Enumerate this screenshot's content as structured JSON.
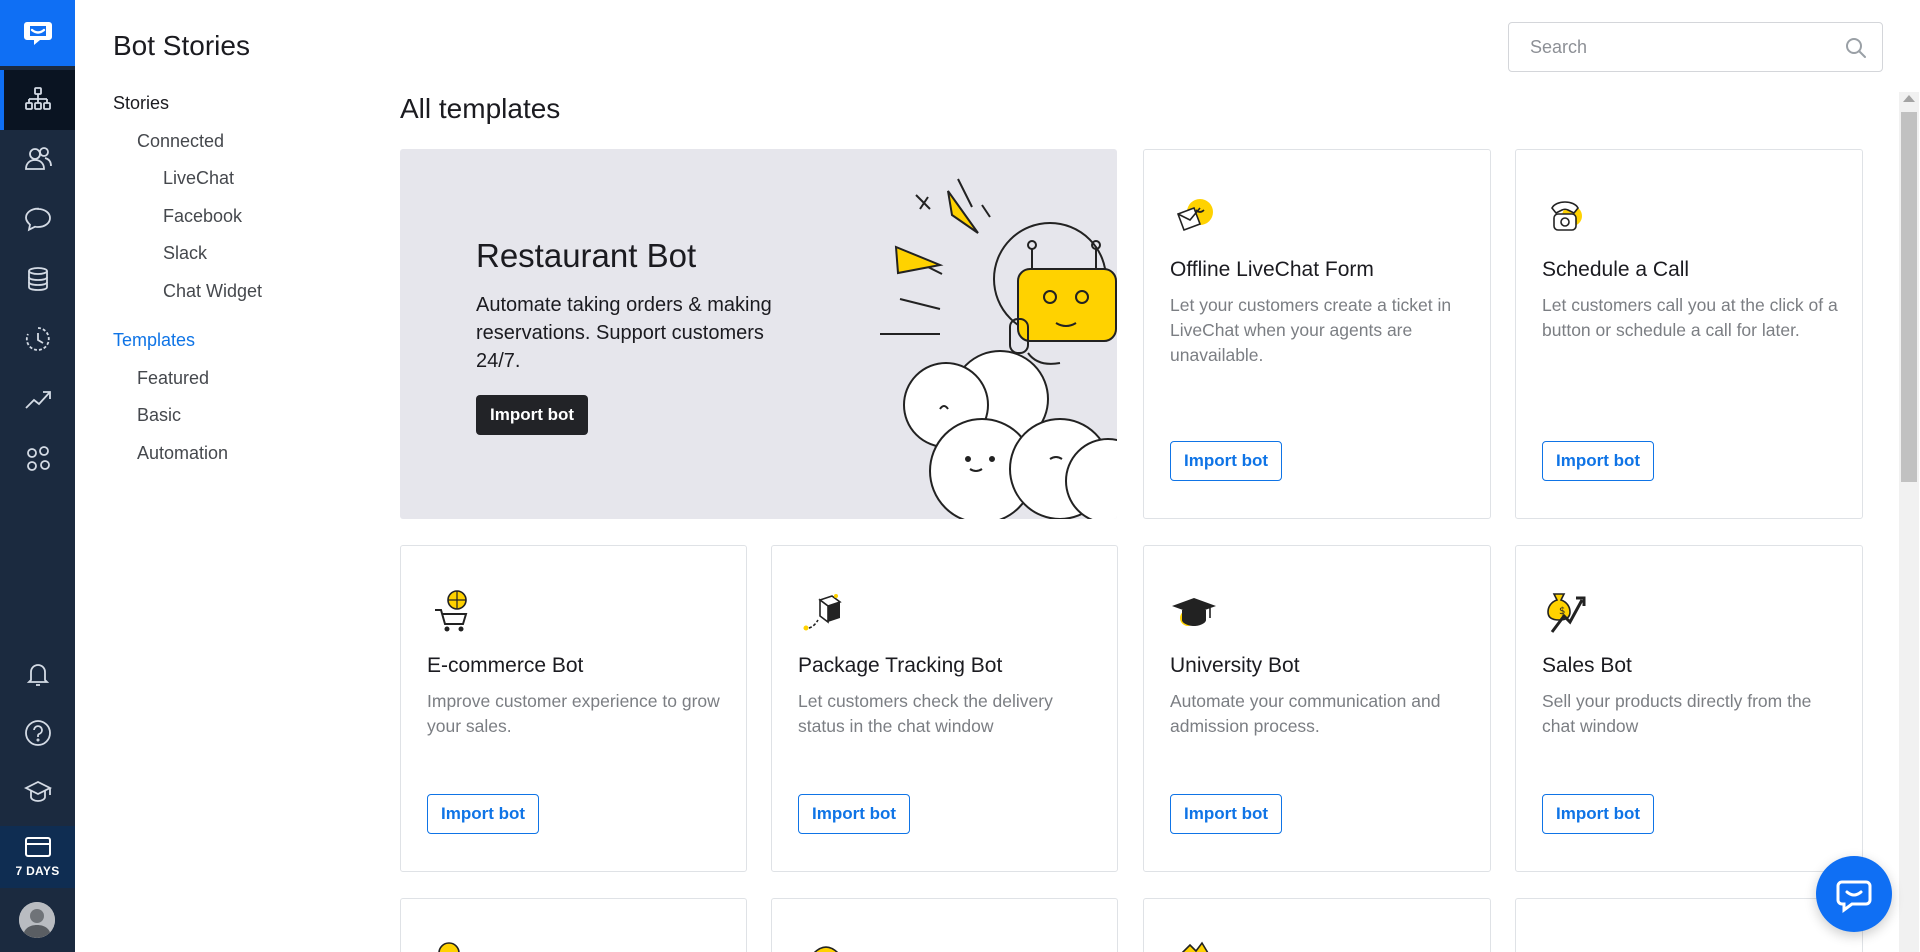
{
  "app": {
    "brand_color": "#0f6ff4",
    "rail_color": "#1b2a3f"
  },
  "rail": {
    "trial_label": "7 DAYS",
    "items": [
      "bot-stories-icon",
      "users-icon",
      "chat-icon",
      "database-icon",
      "history-icon",
      "reports-icon",
      "integrations-icon",
      "bell-icon",
      "help-icon",
      "academy-icon"
    ]
  },
  "subnav": {
    "title": "Bot Stories",
    "stories": "Stories",
    "connected": "Connected",
    "livechat": "LiveChat",
    "facebook": "Facebook",
    "slack": "Slack",
    "chat_widget": "Chat Widget",
    "templates": "Templates",
    "featured": "Featured",
    "basic": "Basic",
    "automation": "Automation"
  },
  "search": {
    "placeholder": "Search"
  },
  "main": {
    "title": "All templates",
    "hero": {
      "title": "Restaurant Bot",
      "description": "Automate taking orders & making reservations. Support customers 24/7.",
      "button": "Import bot"
    },
    "cards": [
      {
        "title": "Offline LiveChat Form",
        "description": "Let your customers create a ticket in LiveChat when your agents are unavailable.",
        "button": "Import bot",
        "icon": "envelope-icon"
      },
      {
        "title": "Schedule a Call",
        "description": "Let customers call you at the click of a button or schedule a call for later.",
        "button": "Import bot",
        "icon": "phone-icon"
      },
      {
        "title": "E-commerce Bot",
        "description": "Improve customer experience to grow your sales.",
        "button": "Import bot",
        "icon": "cart-icon"
      },
      {
        "title": "Package Tracking Bot",
        "description": "Let customers check the delivery status in the chat window",
        "button": "Import bot",
        "icon": "package-icon"
      },
      {
        "title": "University Bot",
        "description": "Automate your communication and admission process.",
        "button": "Import bot",
        "icon": "graduation-cap-icon"
      },
      {
        "title": "Sales Bot",
        "description": "Sell your products directly from the chat window",
        "button": "Import bot",
        "icon": "money-bag-icon"
      }
    ]
  }
}
